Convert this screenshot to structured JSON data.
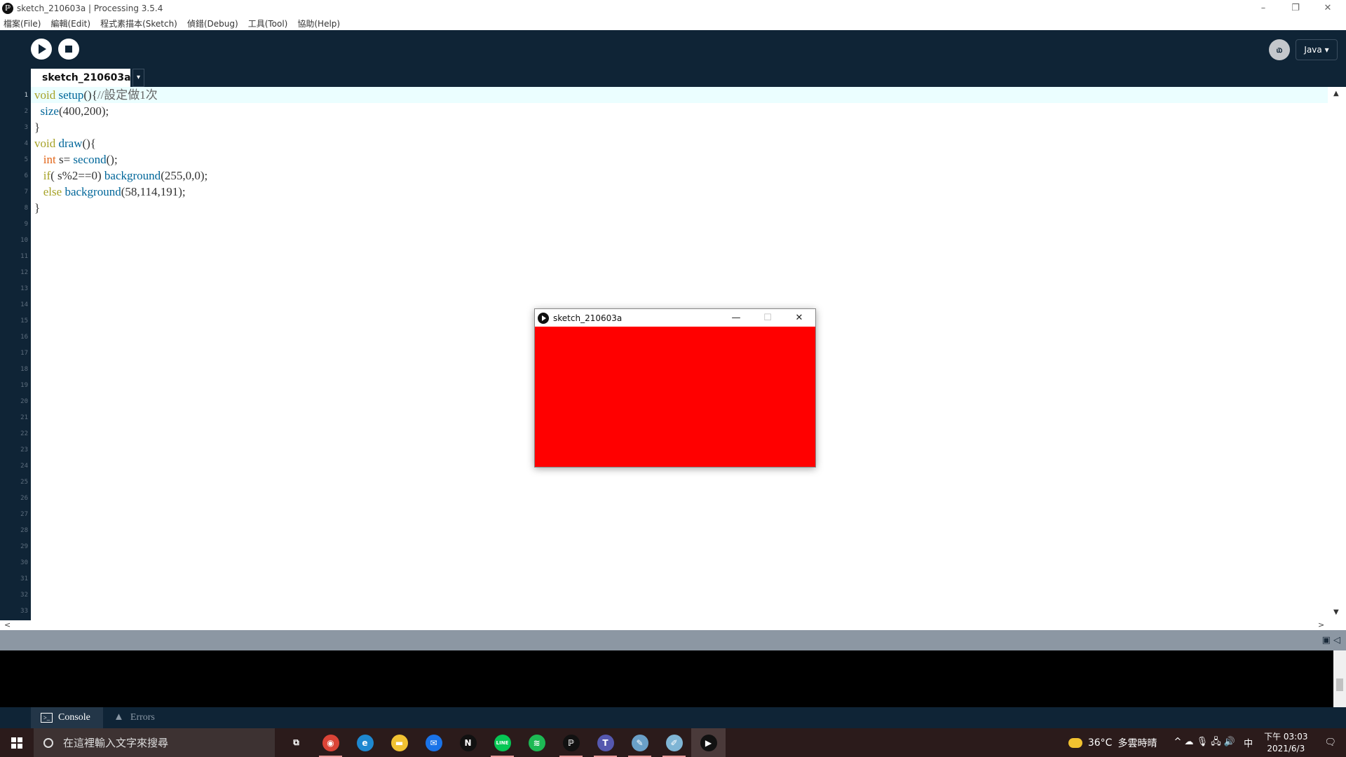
{
  "window": {
    "title": "sketch_210603a | Processing 3.5.4",
    "app_icon_glyph": "ℙ",
    "controls": {
      "minimize": "–",
      "restore": "❐",
      "close": "✕"
    }
  },
  "menu": {
    "items": [
      "檔案(File)",
      "編輯(Edit)",
      "程式素描本(Sketch)",
      "偵錯(Debug)",
      "工具(Tool)",
      "協助(Help)"
    ]
  },
  "toolbar": {
    "run": "run-icon",
    "stop": "stop-icon",
    "mode_icon_glyph": "௰",
    "mode_label": "Java ▾"
  },
  "editor": {
    "tab_name": "sketch_210603a",
    "tab_arrow": "▾",
    "line_count": 33,
    "active_line": 1,
    "code_lines": [
      [
        {
          "t": "void",
          "c": "kw"
        },
        {
          "t": " "
        },
        {
          "t": "setup",
          "c": "fn"
        },
        {
          "t": "(){"
        },
        {
          "t": "//設定做1次",
          "c": "cm"
        }
      ],
      [
        {
          "t": "  "
        },
        {
          "t": "size",
          "c": "fn"
        },
        {
          "t": "(400,200);"
        }
      ],
      [
        {
          "t": "}"
        }
      ],
      [
        {
          "t": "void",
          "c": "kw"
        },
        {
          "t": " "
        },
        {
          "t": "draw",
          "c": "fn"
        },
        {
          "t": "(){"
        }
      ],
      [
        {
          "t": "   "
        },
        {
          "t": "int",
          "c": "ty"
        },
        {
          "t": " s= "
        },
        {
          "t": "second",
          "c": "fn"
        },
        {
          "t": "();"
        }
      ],
      [
        {
          "t": "   "
        },
        {
          "t": "if",
          "c": "kw"
        },
        {
          "t": "( s%2==0) "
        },
        {
          "t": "background",
          "c": "fn"
        },
        {
          "t": "(255,0,0);"
        }
      ],
      [
        {
          "t": "   "
        },
        {
          "t": "else",
          "c": "kw"
        },
        {
          "t": " "
        },
        {
          "t": "background",
          "c": "fn"
        },
        {
          "t": "(58,114,191);"
        }
      ],
      [
        {
          "t": "}"
        }
      ]
    ]
  },
  "scroll": {
    "left": "<",
    "right": ">",
    "up": "▲",
    "down": "▼"
  },
  "status": {
    "icons": "▣  ◁"
  },
  "console_tabs": {
    "console": "Console",
    "errors": "Errors",
    "console_sym": ">_",
    "errors_sym": "▲"
  },
  "sketch_window": {
    "title": "sketch_210603a",
    "canvas_color": "#ff0000",
    "minimize": "—",
    "maximize": "☐",
    "close": "✕"
  },
  "taskbar": {
    "search_placeholder": "在這裡輸入文字來搜尋",
    "apps": [
      {
        "name": "task-view",
        "glyph": "⧉",
        "color": "transparent",
        "state": ""
      },
      {
        "name": "chrome",
        "glyph": "◉",
        "color": "#db4437",
        "state": "open"
      },
      {
        "name": "edge",
        "glyph": "e",
        "color": "#1e88d0",
        "state": ""
      },
      {
        "name": "file-explorer",
        "glyph": "▬",
        "color": "#f1c232",
        "state": ""
      },
      {
        "name": "mail",
        "glyph": "✉",
        "color": "#1a73e8",
        "state": ""
      },
      {
        "name": "netflix",
        "glyph": "N",
        "color": "#111111",
        "state": ""
      },
      {
        "name": "line",
        "glyph": "LINE",
        "color": "#06c755",
        "state": "open"
      },
      {
        "name": "spotify",
        "glyph": "≋",
        "color": "#1db954",
        "state": ""
      },
      {
        "name": "processing",
        "glyph": "ℙ",
        "color": "#111111",
        "state": "open"
      },
      {
        "name": "teams",
        "glyph": "T",
        "color": "#5558af",
        "state": "open"
      },
      {
        "name": "paint",
        "glyph": "✎",
        "color": "#6aa0c8",
        "state": "open"
      },
      {
        "name": "notes",
        "glyph": "✐",
        "color": "#7fb5d5",
        "state": "open"
      },
      {
        "name": "sketch-runner",
        "glyph": "▶",
        "color": "#111111",
        "state": "focused"
      }
    ],
    "weather_temp": "36°C",
    "weather_text": "多雲時晴",
    "tray_icons": "^  ☁  🎙  🖧  🔊",
    "ime": "中",
    "time": "下午 03:03",
    "date": "2021/6/3",
    "notify": "🗨"
  }
}
